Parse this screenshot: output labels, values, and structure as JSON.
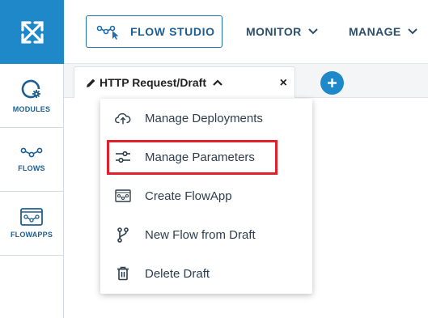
{
  "header": {
    "flow_studio_label": "FLOW STUDIO",
    "nav": [
      {
        "label": "MONITOR"
      },
      {
        "label": "MANAGE"
      }
    ]
  },
  "sidebar": {
    "items": [
      {
        "label": "MODULES",
        "icon": "modules-icon"
      },
      {
        "label": "FLOWS",
        "icon": "flows-icon"
      },
      {
        "label": "FLOWAPPS",
        "icon": "flowapps-icon"
      }
    ]
  },
  "tab": {
    "title": "HTTP Request/Draft",
    "close": "×",
    "add": "+"
  },
  "menu": {
    "items": [
      {
        "label": "Manage Deployments",
        "icon": "cloud-upload-icon"
      },
      {
        "label": "Manage Parameters",
        "icon": "sliders-icon",
        "highlighted": true
      },
      {
        "label": "Create FlowApp",
        "icon": "flowapp-icon"
      },
      {
        "label": "New Flow from Draft",
        "icon": "branch-icon"
      },
      {
        "label": "Delete Draft",
        "icon": "trash-icon"
      }
    ]
  },
  "colors": {
    "brand_blue": "#1e88c9",
    "text_blue": "#1e5f93",
    "highlight_red": "#e2202b"
  }
}
